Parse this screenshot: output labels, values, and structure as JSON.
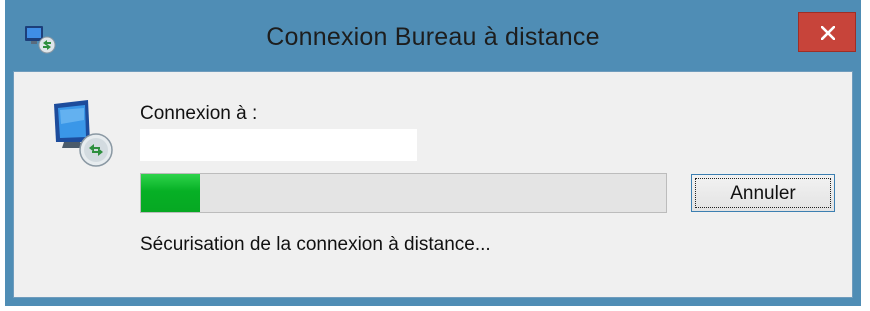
{
  "window": {
    "title": "Connexion Bureau à distance",
    "close_icon": "close-icon",
    "app_icon": "remote-desktop-icon"
  },
  "dialog": {
    "connect_label": "Connexion à :",
    "server_value": "",
    "progress_fraction": 0.113,
    "cancel_label": "Annuler",
    "status_text": "Sécurisation de la connexion à distance...",
    "icon": "remote-desktop-monitor-icon"
  },
  "colors": {
    "titlebar": "#4f8db5",
    "close_button": "#c7443a",
    "progress_fill": "#06b025",
    "dialog_background": "#f0f0f0"
  }
}
